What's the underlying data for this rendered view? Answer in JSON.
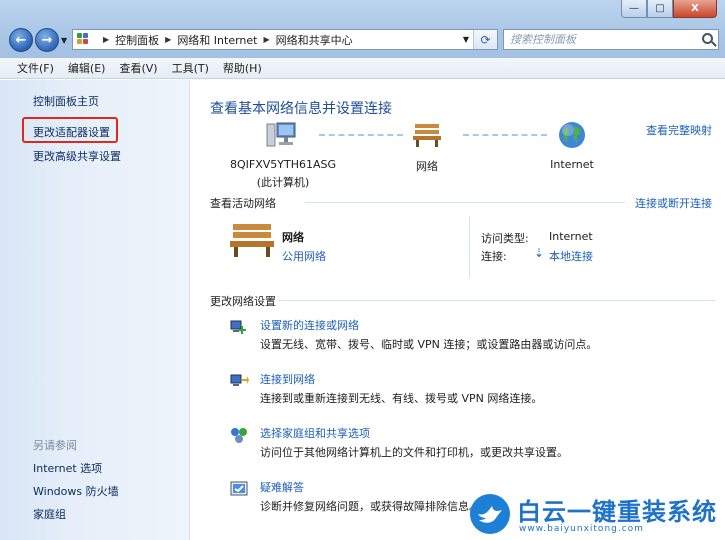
{
  "window": {
    "min_label": "—",
    "max_label": "□",
    "close_label": "X"
  },
  "nav": {
    "back_label": "←",
    "forward_label": "→"
  },
  "address": {
    "crumbs": [
      "控制面板",
      "网络和 Internet",
      "网络和共享中心"
    ]
  },
  "search": {
    "placeholder": "搜索控制面板"
  },
  "menu": {
    "items": [
      "文件(F)",
      "编辑(E)",
      "查看(V)",
      "工具(T)",
      "帮助(H)"
    ]
  },
  "sidebar": {
    "home": "控制面板主页",
    "items": [
      "更改适配器设置",
      "更改高级共享设置"
    ],
    "see_also_title": "另请参阅",
    "see_also": [
      "Internet 选项",
      "Windows 防火墙",
      "家庭组"
    ]
  },
  "main": {
    "title": "查看基本网络信息并设置连接",
    "full_map": "查看完整映射",
    "nodes": [
      {
        "label": "8QIFXV5YTH61ASG",
        "sub": "(此计算机)"
      },
      {
        "label": "网络",
        "sub": ""
      },
      {
        "label": "Internet",
        "sub": ""
      }
    ],
    "active_title": "查看活动网络",
    "connect_disconnect": "连接或断开连接",
    "network_name": "网络",
    "network_type": "公用网络",
    "access_type_label": "访问类型:",
    "access_type_value": "Internet",
    "connections_label": "连接:",
    "connections_value": "本地连接",
    "change_title": "更改网络设置",
    "tasks": [
      {
        "link": "设置新的连接或网络",
        "desc": "设置无线、宽带、拨号、临时或 VPN 连接；或设置路由器或访问点。"
      },
      {
        "link": "连接到网络",
        "desc": "连接到或重新连接到无线、有线、拨号或 VPN 网络连接。"
      },
      {
        "link": "选择家庭组和共享选项",
        "desc": "访问位于其他网络计算机上的文件和打印机，或更改共享设置。"
      },
      {
        "link": "疑难解答",
        "desc": "诊断并修复网络问题，或获得故障排除信息。"
      }
    ]
  },
  "watermark": {
    "brand": "白云一键重装系统",
    "url": "www.baiyunxitong.com"
  },
  "colors": {
    "link": "#1e5fb8",
    "title": "#1e4e9a",
    "highlight": "#e0281e"
  }
}
